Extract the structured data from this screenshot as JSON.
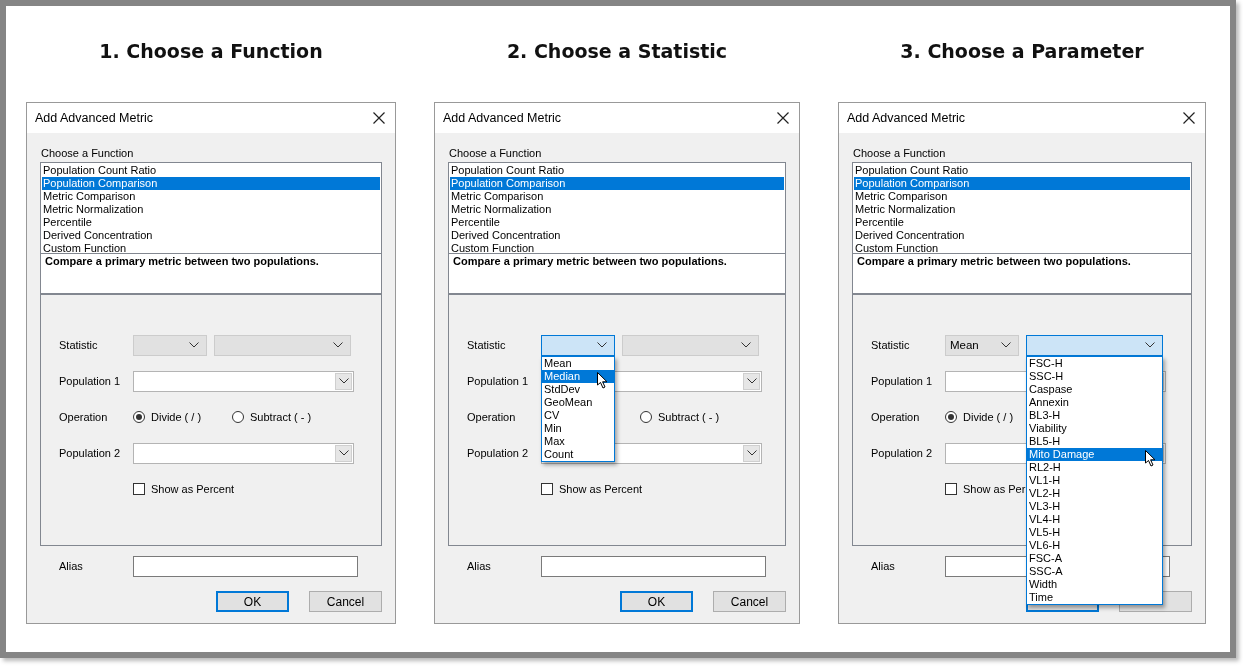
{
  "panels": [
    {
      "heading": "1. Choose a Function",
      "dialog": {
        "title": "Add Advanced Metric",
        "function_label": "Choose a Function",
        "functions": [
          {
            "label": "Population Count Ratio",
            "selected": false
          },
          {
            "label": "Population Comparison",
            "selected": true
          },
          {
            "label": "Metric Comparison",
            "selected": false
          },
          {
            "label": "Metric Normalization",
            "selected": false
          },
          {
            "label": "Percentile",
            "selected": false
          },
          {
            "label": "Derived Concentration",
            "selected": false
          },
          {
            "label": "Custom Function",
            "selected": false
          }
        ],
        "description": "Compare a primary metric between two populations.",
        "statistic": {
          "label": "Statistic",
          "combos": [
            {
              "open": false
            },
            {
              "open": false
            }
          ]
        },
        "population_1": {
          "label": "Population 1"
        },
        "operation": {
          "label": "Operation",
          "options": [
            {
              "kind": "divide",
              "label": "Divide ( / )",
              "selected": true
            },
            {
              "kind": "subtract",
              "label": "Subtract ( - )",
              "selected": false
            }
          ]
        },
        "population_2": {
          "label": "Population 2"
        },
        "percent": {
          "label": "Show as Percent",
          "checked": false
        },
        "alias": {
          "label": "Alias"
        },
        "buttons": [
          {
            "kind": "ok",
            "label": "OK"
          },
          {
            "kind": "cancel",
            "label": "Cancel"
          }
        ]
      }
    },
    {
      "heading": "2. Choose a Statistic",
      "dialog": {
        "title": "Add Advanced Metric",
        "function_label": "Choose a Function",
        "functions": [
          {
            "label": "Population Count Ratio",
            "selected": false
          },
          {
            "label": "Population Comparison",
            "selected": true
          },
          {
            "label": "Metric Comparison",
            "selected": false
          },
          {
            "label": "Metric Normalization",
            "selected": false
          },
          {
            "label": "Percentile",
            "selected": false
          },
          {
            "label": "Derived Concentration",
            "selected": false
          },
          {
            "label": "Custom Function",
            "selected": false
          }
        ],
        "description": "Compare a primary metric between two populations.",
        "statistic": {
          "label": "Statistic",
          "combos": [
            {
              "open": true,
              "options": [
                {
                  "label": "Mean",
                  "selected": false
                },
                {
                  "label": "Median",
                  "selected": true
                },
                {
                  "label": "StdDev",
                  "selected": false
                },
                {
                  "label": "GeoMean",
                  "selected": false
                },
                {
                  "label": "CV",
                  "selected": false
                },
                {
                  "label": "Min",
                  "selected": false
                },
                {
                  "label": "Max",
                  "selected": false
                },
                {
                  "label": "Count",
                  "selected": false
                }
              ]
            },
            {
              "open": false
            }
          ]
        },
        "population_1": {
          "label": "Population 1"
        },
        "operation": {
          "label": "Operation",
          "options": [
            {
              "kind": "subtract",
              "label": "Subtract ( - )",
              "selected": false
            }
          ]
        },
        "population_2": {
          "label": "Population 2"
        },
        "percent": {
          "label": "Show as Percent",
          "checked": false
        },
        "alias": {
          "label": "Alias"
        },
        "buttons": [
          {
            "kind": "ok",
            "label": "OK"
          },
          {
            "kind": "cancel",
            "label": "Cancel"
          }
        ]
      }
    },
    {
      "heading": "3. Choose a Parameter",
      "dialog": {
        "title": "Add Advanced Metric",
        "function_label": "Choose a Function",
        "functions": [
          {
            "label": "Population Count Ratio",
            "selected": false
          },
          {
            "label": "Population Comparison",
            "selected": true
          },
          {
            "label": "Metric Comparison",
            "selected": false
          },
          {
            "label": "Metric Normalization",
            "selected": false
          },
          {
            "label": "Percentile",
            "selected": false
          },
          {
            "label": "Derived Concentration",
            "selected": false
          },
          {
            "label": "Custom Function",
            "selected": false
          }
        ],
        "description": "Compare a primary metric between two populations.",
        "statistic": {
          "label": "Statistic",
          "combos": [
            {
              "open": false,
              "value": "Mean"
            },
            {
              "open": true,
              "options": [
                {
                  "label": "FSC-H",
                  "selected": false
                },
                {
                  "label": "SSC-H",
                  "selected": false
                },
                {
                  "label": "Caspase",
                  "selected": false
                },
                {
                  "label": "Annexin",
                  "selected": false
                },
                {
                  "label": "BL3-H",
                  "selected": false
                },
                {
                  "label": "Viability",
                  "selected": false
                },
                {
                  "label": "BL5-H",
                  "selected": false
                },
                {
                  "label": "Mito Damage",
                  "selected": true
                },
                {
                  "label": "RL2-H",
                  "selected": false
                },
                {
                  "label": "VL1-H",
                  "selected": false
                },
                {
                  "label": "VL2-H",
                  "selected": false
                },
                {
                  "label": "VL3-H",
                  "selected": false
                },
                {
                  "label": "VL4-H",
                  "selected": false
                },
                {
                  "label": "VL5-H",
                  "selected": false
                },
                {
                  "label": "VL6-H",
                  "selected": false
                },
                {
                  "label": "FSC-A",
                  "selected": false
                },
                {
                  "label": "SSC-A",
                  "selected": false
                },
                {
                  "label": "Width",
                  "selected": false
                },
                {
                  "label": "Time",
                  "selected": false
                }
              ]
            }
          ]
        },
        "population_1": {
          "label": "Population 1"
        },
        "operation": {
          "label": "Operation",
          "options": [
            {
              "kind": "divide",
              "label": "Divide ( / )",
              "selected": true
            }
          ]
        },
        "population_2": {
          "label": "Population 2"
        },
        "percent": {
          "label": "Show as Per",
          "checked": false
        },
        "alias": {
          "label": "Alias"
        },
        "buttons": [
          {
            "kind": "ok"
          },
          {
            "kind": "cancel"
          }
        ]
      }
    }
  ]
}
